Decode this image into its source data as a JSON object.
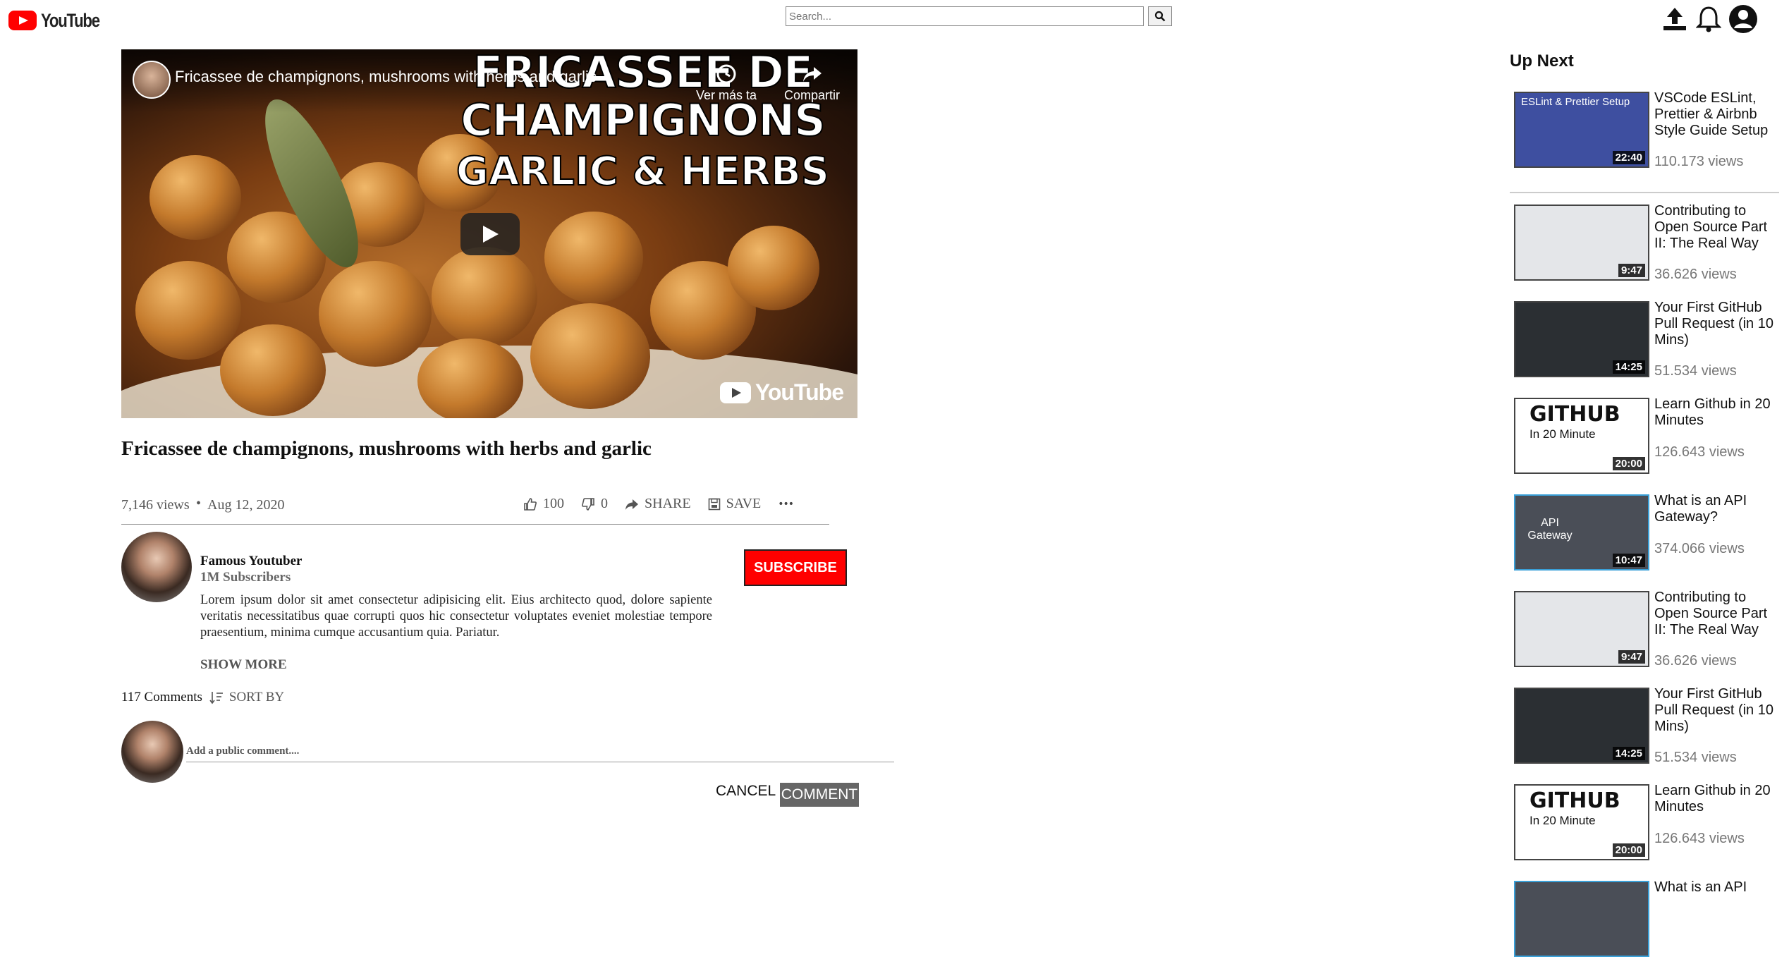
{
  "header": {
    "logo_text": "YouTube",
    "search_placeholder": "Search..."
  },
  "player": {
    "overlay_title": "Fricassee de champignons, mushrooms with herbs and garlic",
    "headline_line1": "FRICASSEE DE",
    "headline_line2": "CHAMPIGNONS",
    "headline_line3": "GARLIC & HERBS",
    "watch_later_label": "Ver más ta",
    "share_label": "Compartir",
    "watermark": "YouTube"
  },
  "video": {
    "title": "Fricassee de champignons, mushrooms with herbs and garlic",
    "views": "7,146 views",
    "separator": "•",
    "date": "Aug 12, 2020",
    "likes": "100",
    "dislikes": "0",
    "share_label": "SHARE",
    "save_label": "SAVE",
    "more_label": "•••"
  },
  "channel": {
    "name": "Famous Youtuber",
    "subscribers": "1M Subscribers",
    "subscribe_label": "SUBSCRIBE",
    "description": "Lorem ipsum dolor sit amet consectetur adipisicing elit. Eius architecto quod, dolore sapiente veritatis necessitatibus quae corrupti quos hic consectetur voluptates eveniet molestiae tempore praesentium, minima cumque accusantium quia. Pariatur.",
    "show_more": "SHOW MORE"
  },
  "comments": {
    "count": "117 Comments",
    "sort_label": "SORT BY",
    "input_placeholder": "Add a public comment....",
    "cancel_label": "CANCEL",
    "comment_label": "COMMENT"
  },
  "up_next": {
    "title": "Up Next",
    "items": [
      {
        "title": "VSCode ESLint, Prettier & Airbnb Style Guide Setup",
        "views": "110.173 views",
        "duration": "22:40",
        "thumb_text": "ESLint & Prettier Setup"
      },
      {
        "title": "Contributing to Open Source Part II: The Real Way",
        "views": "36.626 views",
        "duration": "9:47"
      },
      {
        "title": "Your First GitHub Pull Request (in 10 Mins)",
        "views": "51.534 views",
        "duration": "14:25"
      },
      {
        "title": "Learn Github in 20 Minutes",
        "views": "126.643 views",
        "duration": "20:00",
        "thumb_text": "GITHUB",
        "thumb_sub": "In 20 Minute"
      },
      {
        "title": "What is an API Gateway?",
        "views": "374.066 views",
        "duration": "10:47",
        "thumb_text": "API Gateway"
      },
      {
        "title": "Contributing to Open Source Part II: The Real Way",
        "views": "36.626 views",
        "duration": "9:47"
      },
      {
        "title": "Your First GitHub Pull Request (in 10 Mins)",
        "views": "51.534 views",
        "duration": "14:25"
      },
      {
        "title": "Learn Github in 20 Minutes",
        "views": "126.643 views",
        "duration": "20:00",
        "thumb_text": "GITHUB",
        "thumb_sub": "In 20 Minute"
      },
      {
        "title": "What is an API",
        "views": "",
        "duration": ""
      }
    ]
  },
  "colors": {
    "brand_red": "#ff0000",
    "comment_button": "#666666",
    "views_gray": "#777777"
  }
}
